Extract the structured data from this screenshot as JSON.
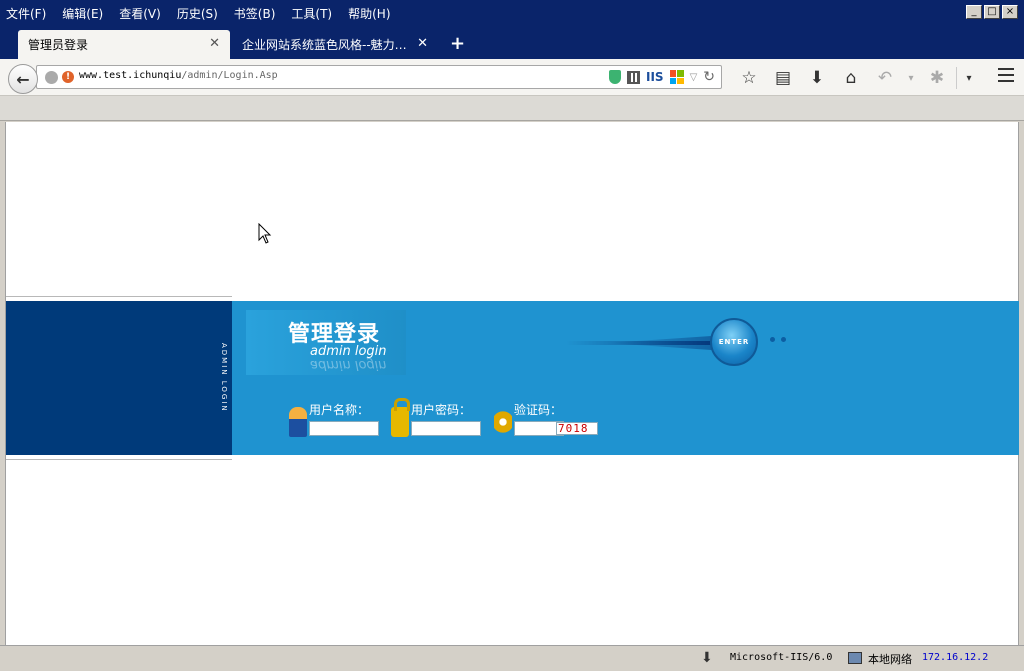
{
  "menu": [
    "文件(F)",
    "编辑(E)",
    "查看(V)",
    "历史(S)",
    "书签(B)",
    "工具(T)",
    "帮助(H)"
  ],
  "tabs": [
    {
      "label": "管理员登录",
      "active": true
    },
    {
      "label": "企业网站系统蓝色风格--魅力…",
      "active": false
    }
  ],
  "newtab_label": "+",
  "address": {
    "host": "www.test.ichunqiu",
    "path": "/admin/Login.Asp"
  },
  "url_icons": {
    "iis": "IIS"
  },
  "login": {
    "vertical_text": "ADMIN LOGIN",
    "title_cn": "管理登录",
    "title_en": "admin login",
    "enter": "ENTER",
    "user_label": "用户名称：",
    "pass_label": "用户密码：",
    "code_label": "验证码：",
    "captcha": "7018",
    "user_value": "",
    "pass_value": "",
    "code_value": ""
  },
  "status": {
    "server": "Microsoft-IIS/6.0",
    "network": "本地网络",
    "ip": "172.16.12.2"
  },
  "colors": {
    "titlebar": "#0a246a",
    "band": "#1f93d0",
    "band_dark": "#003a7a"
  }
}
